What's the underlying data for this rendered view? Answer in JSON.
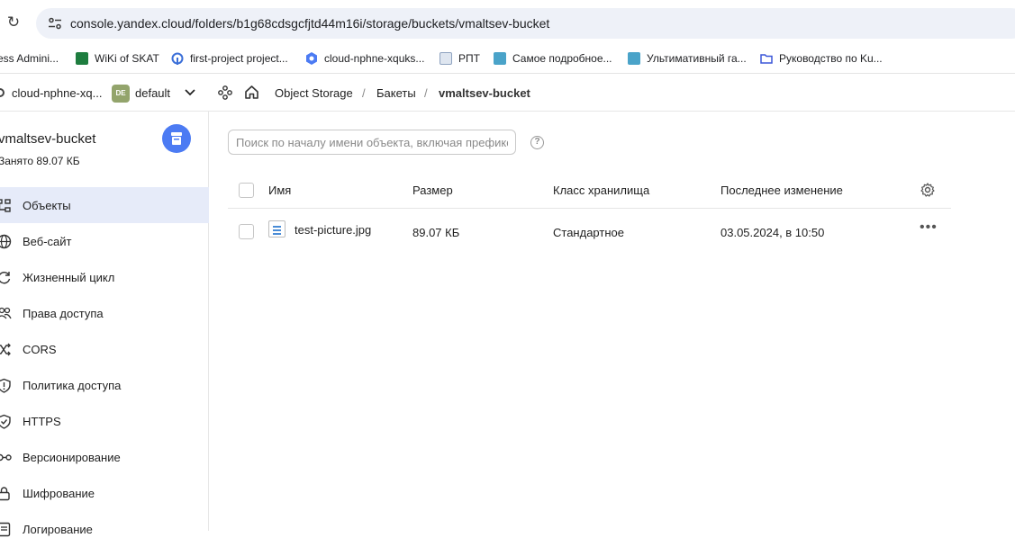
{
  "browser": {
    "url": "console.yandex.cloud/folders/b1g68cdsgcfjtd44m16i/storage/buckets/vmaltsev-bucket"
  },
  "bookmarks": [
    {
      "label": "ess Admini...",
      "icon": "generic-icon",
      "color": "#ffffff"
    },
    {
      "label": "WiKi of SKAT",
      "icon": "wiki-icon",
      "color": "#1e7d3f"
    },
    {
      "label": "first-project project...",
      "icon": "gitlab-icon",
      "color": "#3b6fd8"
    },
    {
      "label": "cloud-nphne-xquks...",
      "icon": "yandex-cloud-icon",
      "color": "#4c7bf3"
    },
    {
      "label": "РПТ",
      "icon": "doc-icon",
      "color": "#8fa3c0"
    },
    {
      "label": "Самое подробное...",
      "icon": "site-icon",
      "color": "#4aa3c9"
    },
    {
      "label": "Ультимативный га...",
      "icon": "site-icon",
      "color": "#4aa3c9"
    },
    {
      "label": "Руководство по Ku...",
      "icon": "folder-icon",
      "color": "#3b57d8"
    }
  ],
  "header": {
    "cloud": "cloud-nphne-xq...",
    "folder_badge": "DE",
    "folder": "default",
    "breadcrumbs": [
      "Object Storage",
      "Бакеты",
      "vmaltsev-bucket"
    ]
  },
  "sidebar": {
    "bucket_name": "vmaltsev-bucket",
    "used": "Занято 89.07 КБ",
    "items": [
      {
        "label": "Объекты",
        "icon": "objects-icon",
        "active": true
      },
      {
        "label": "Веб-сайт",
        "icon": "globe-icon"
      },
      {
        "label": "Жизненный цикл",
        "icon": "lifecycle-icon"
      },
      {
        "label": "Права доступа",
        "icon": "persons-icon"
      },
      {
        "label": "CORS",
        "icon": "shuffle-icon"
      },
      {
        "label": "Политика доступа",
        "icon": "shield-icon"
      },
      {
        "label": "HTTPS",
        "icon": "shield-check-icon"
      },
      {
        "label": "Версионирование",
        "icon": "versions-icon"
      },
      {
        "label": "Шифрование",
        "icon": "lock-icon"
      },
      {
        "label": "Логирование",
        "icon": "log-icon"
      }
    ]
  },
  "search": {
    "placeholder": "Поиск по началу имени объекта, включая префикс"
  },
  "table": {
    "columns": [
      "Имя",
      "Размер",
      "Класс хранилища",
      "Последнее изменение"
    ],
    "rows": [
      {
        "name": "test-picture.jpg",
        "size": "89.07 КБ",
        "storage_class": "Стандартное",
        "modified": "03.05.2024, в 10:50"
      }
    ]
  },
  "colors": {
    "accent": "#4c7bf3",
    "active_nav_bg": "#e6ebf9"
  }
}
